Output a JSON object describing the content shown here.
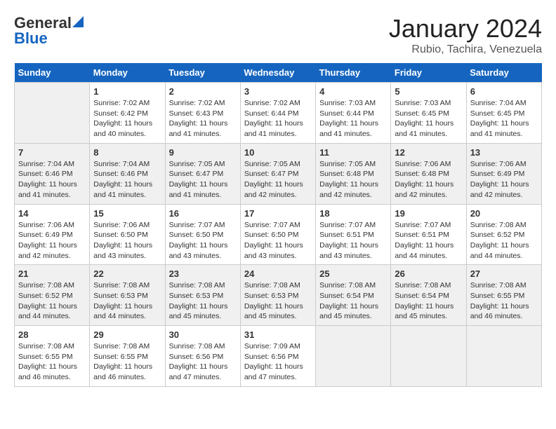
{
  "header": {
    "logo_general": "General",
    "logo_blue": "Blue",
    "title": "January 2024",
    "subtitle": "Rubio, Tachira, Venezuela"
  },
  "days_of_week": [
    "Sunday",
    "Monday",
    "Tuesday",
    "Wednesday",
    "Thursday",
    "Friday",
    "Saturday"
  ],
  "weeks": [
    [
      {
        "num": "",
        "info": ""
      },
      {
        "num": "1",
        "info": "Sunrise: 7:02 AM\nSunset: 6:42 PM\nDaylight: 11 hours\nand 40 minutes."
      },
      {
        "num": "2",
        "info": "Sunrise: 7:02 AM\nSunset: 6:43 PM\nDaylight: 11 hours\nand 41 minutes."
      },
      {
        "num": "3",
        "info": "Sunrise: 7:02 AM\nSunset: 6:44 PM\nDaylight: 11 hours\nand 41 minutes."
      },
      {
        "num": "4",
        "info": "Sunrise: 7:03 AM\nSunset: 6:44 PM\nDaylight: 11 hours\nand 41 minutes."
      },
      {
        "num": "5",
        "info": "Sunrise: 7:03 AM\nSunset: 6:45 PM\nDaylight: 11 hours\nand 41 minutes."
      },
      {
        "num": "6",
        "info": "Sunrise: 7:04 AM\nSunset: 6:45 PM\nDaylight: 11 hours\nand 41 minutes."
      }
    ],
    [
      {
        "num": "7",
        "info": "Sunrise: 7:04 AM\nSunset: 6:46 PM\nDaylight: 11 hours\nand 41 minutes."
      },
      {
        "num": "8",
        "info": "Sunrise: 7:04 AM\nSunset: 6:46 PM\nDaylight: 11 hours\nand 41 minutes."
      },
      {
        "num": "9",
        "info": "Sunrise: 7:05 AM\nSunset: 6:47 PM\nDaylight: 11 hours\nand 41 minutes."
      },
      {
        "num": "10",
        "info": "Sunrise: 7:05 AM\nSunset: 6:47 PM\nDaylight: 11 hours\nand 42 minutes."
      },
      {
        "num": "11",
        "info": "Sunrise: 7:05 AM\nSunset: 6:48 PM\nDaylight: 11 hours\nand 42 minutes."
      },
      {
        "num": "12",
        "info": "Sunrise: 7:06 AM\nSunset: 6:48 PM\nDaylight: 11 hours\nand 42 minutes."
      },
      {
        "num": "13",
        "info": "Sunrise: 7:06 AM\nSunset: 6:49 PM\nDaylight: 11 hours\nand 42 minutes."
      }
    ],
    [
      {
        "num": "14",
        "info": "Sunrise: 7:06 AM\nSunset: 6:49 PM\nDaylight: 11 hours\nand 42 minutes."
      },
      {
        "num": "15",
        "info": "Sunrise: 7:06 AM\nSunset: 6:50 PM\nDaylight: 11 hours\nand 43 minutes."
      },
      {
        "num": "16",
        "info": "Sunrise: 7:07 AM\nSunset: 6:50 PM\nDaylight: 11 hours\nand 43 minutes."
      },
      {
        "num": "17",
        "info": "Sunrise: 7:07 AM\nSunset: 6:50 PM\nDaylight: 11 hours\nand 43 minutes."
      },
      {
        "num": "18",
        "info": "Sunrise: 7:07 AM\nSunset: 6:51 PM\nDaylight: 11 hours\nand 43 minutes."
      },
      {
        "num": "19",
        "info": "Sunrise: 7:07 AM\nSunset: 6:51 PM\nDaylight: 11 hours\nand 44 minutes."
      },
      {
        "num": "20",
        "info": "Sunrise: 7:08 AM\nSunset: 6:52 PM\nDaylight: 11 hours\nand 44 minutes."
      }
    ],
    [
      {
        "num": "21",
        "info": "Sunrise: 7:08 AM\nSunset: 6:52 PM\nDaylight: 11 hours\nand 44 minutes."
      },
      {
        "num": "22",
        "info": "Sunrise: 7:08 AM\nSunset: 6:53 PM\nDaylight: 11 hours\nand 44 minutes."
      },
      {
        "num": "23",
        "info": "Sunrise: 7:08 AM\nSunset: 6:53 PM\nDaylight: 11 hours\nand 45 minutes."
      },
      {
        "num": "24",
        "info": "Sunrise: 7:08 AM\nSunset: 6:53 PM\nDaylight: 11 hours\nand 45 minutes."
      },
      {
        "num": "25",
        "info": "Sunrise: 7:08 AM\nSunset: 6:54 PM\nDaylight: 11 hours\nand 45 minutes."
      },
      {
        "num": "26",
        "info": "Sunrise: 7:08 AM\nSunset: 6:54 PM\nDaylight: 11 hours\nand 45 minutes."
      },
      {
        "num": "27",
        "info": "Sunrise: 7:08 AM\nSunset: 6:55 PM\nDaylight: 11 hours\nand 46 minutes."
      }
    ],
    [
      {
        "num": "28",
        "info": "Sunrise: 7:08 AM\nSunset: 6:55 PM\nDaylight: 11 hours\nand 46 minutes."
      },
      {
        "num": "29",
        "info": "Sunrise: 7:08 AM\nSunset: 6:55 PM\nDaylight: 11 hours\nand 46 minutes."
      },
      {
        "num": "30",
        "info": "Sunrise: 7:08 AM\nSunset: 6:56 PM\nDaylight: 11 hours\nand 47 minutes."
      },
      {
        "num": "31",
        "info": "Sunrise: 7:09 AM\nSunset: 6:56 PM\nDaylight: 11 hours\nand 47 minutes."
      },
      {
        "num": "",
        "info": ""
      },
      {
        "num": "",
        "info": ""
      },
      {
        "num": "",
        "info": ""
      }
    ]
  ]
}
